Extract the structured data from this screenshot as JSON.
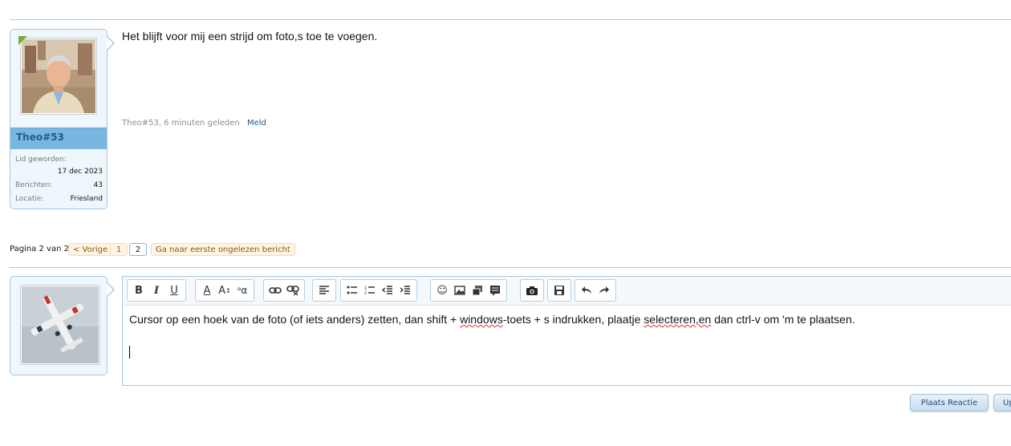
{
  "post": {
    "username": "Theo#53",
    "info": [
      {
        "label": "Lid geworden:",
        "value": "17 dec 2023"
      },
      {
        "label": "Berichten:",
        "value": "43"
      },
      {
        "label": "Locatie:",
        "value": "Friesland"
      }
    ],
    "message": "Het blijft voor mij een strijd om foto,s toe te voegen.",
    "meta_author_time": "Theo#53, 6 minuten geleden",
    "report_label": "Meld"
  },
  "pagination": {
    "label": "Pagina 2 van 2",
    "prev": "< Vorige",
    "pages": [
      "1",
      "2"
    ],
    "unread": "Ga naar eerste ongelezen bericht"
  },
  "editor": {
    "text_part1": "Cursor op een hoek van de foto (of iets anders) zetten, dan shift + ",
    "text_misspelled1": "windows",
    "text_part2": "-toets + s indrukken, plaatje ",
    "text_misspelled2": "selecteren,en",
    "text_part3": " dan ctrl-v om 'm te plaatsen."
  },
  "buttons": {
    "submit": "Plaats Reactie",
    "upload": "Up"
  },
  "colors": {
    "accent": "#7bb6e1",
    "border": "#a5cae4",
    "link": "#176093"
  }
}
